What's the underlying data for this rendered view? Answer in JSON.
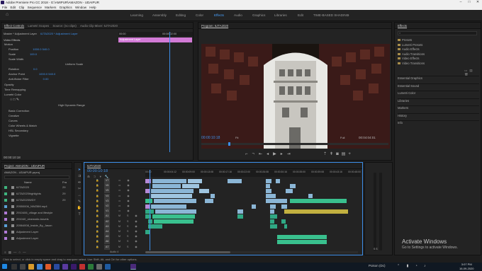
{
  "titlebar": {
    "title": "Adobe Premiere Pro CC 2018 - G:\\AMIPUR\\AMAZON - UDAIPUR"
  },
  "menu": [
    "File",
    "Edit",
    "Clip",
    "Sequence",
    "Markers",
    "Graphics",
    "Window",
    "Help"
  ],
  "workspaces": [
    "Learning",
    "Assembly",
    "Editing",
    "Color",
    "Effects",
    "Audio",
    "Graphics",
    "Libraries",
    "Edit",
    "TIME-BASED SHADING"
  ],
  "active_workspace": "Effects",
  "source_panel": {
    "tabs": [
      "Effect Controls",
      "Lumetri Scopes",
      "Source: (no clips)",
      "Audio Clip Mixer: 6JTA2020"
    ],
    "header": "Master * Adjustment Layer",
    "sequence_ref": "6JTA2020 * Adjustment Layer",
    "ruler_left": "00:00",
    "ruler_right": "00:08:02:00",
    "clip_label": "Adjustment Layer",
    "section": "Video Effects",
    "props": [
      {
        "label": "Motion",
        "value": ""
      },
      {
        "label": "Position",
        "value": "1000.0     540.0"
      },
      {
        "label": "Scale",
        "value": "100.0"
      },
      {
        "label": "Scale Width",
        "value": ""
      },
      {
        "label": "",
        "value": "Uniform Scale"
      },
      {
        "label": "Rotation",
        "value": "0.0"
      },
      {
        "label": "Anchor Point",
        "value": "1000.0     540.0"
      },
      {
        "label": "Anti-flicker Filter",
        "value": "0.00"
      },
      {
        "label": "Opacity",
        "value": ""
      },
      {
        "label": "Time Remapping",
        "value": ""
      },
      {
        "label": "Lumetri Color",
        "value": ""
      },
      {
        "label": "",
        "value": "High Dynamic Range"
      },
      {
        "label": "Basic Correction",
        "value": ""
      },
      {
        "label": "Creative",
        "value": ""
      },
      {
        "label": "Curves",
        "value": ""
      },
      {
        "label": "Color Wheels & Match",
        "value": ""
      },
      {
        "label": "HSL Secondary",
        "value": ""
      },
      {
        "label": "Vignette",
        "value": ""
      }
    ],
    "timecode": "00:00:10:18"
  },
  "program_monitor": {
    "title": "Program: 6JTA2020",
    "timecode": "00:00:10:18",
    "fit": "Fit",
    "quality": "Full",
    "duration": "00:04:04:01"
  },
  "effects_panel": {
    "title": "Effects",
    "items": [
      "Presets",
      "Lumetri Presets",
      "Audio Effects",
      "Audio Transitions",
      "Video Effects",
      "Video Transitions"
    ],
    "sections": [
      "Essential Graphics",
      "Essential Sound",
      "Lumetri Color",
      "Libraries",
      "Markers",
      "History",
      "Info"
    ]
  },
  "project_panel": {
    "title": "Project: AMAZON - UDAIPUR",
    "path": "AMAZON - UDAIPUR.prproj",
    "columns": [
      "Name",
      "Fra"
    ],
    "items": [
      {
        "name": "6JTA2020",
        "color": "#3fb57e"
      },
      {
        "name": "6JTA2020highlights",
        "color": "#3fb57e"
      },
      {
        "name": "6JTA2020WDY",
        "color": "#3fb57e"
      },
      {
        "name": "20550006_NWZ8M.mp4",
        "color": "#5aa0d6"
      },
      {
        "name": "2910406_village and lifestyle",
        "color": "#b07ad6"
      },
      {
        "name": "291040_cinematic-travels",
        "color": "#b07ad6"
      },
      {
        "name": "20564008_Inside_By_Jason",
        "color": "#5aa0d6"
      },
      {
        "name": "Adjustment Layer",
        "color": "#b07ad6"
      },
      {
        "name": "Adjustment Layer",
        "color": "#b07ad6"
      }
    ],
    "frame_values": [
      "29",
      "29",
      "29",
      "",
      "",
      "",
      "",
      "",
      ""
    ]
  },
  "timeline": {
    "tab": "6JTA2020",
    "timecode": "00:00:10:18",
    "ruler": [
      "00:00",
      "00:00:04:12",
      "00:00:09:00",
      "00:00:13:08",
      "00:00:17:16",
      "00:00:22:00",
      "00:00:26:08",
      "00:00:30:16",
      "00:00:35:00",
      "00:00:39:08",
      "00:00:43:16",
      "00:00:48:00"
    ],
    "tracks": [
      "V7",
      "V6",
      "V5",
      "V4",
      "V3",
      "V2",
      "V1",
      "A1",
      "A2",
      "A3",
      "A4",
      "A5",
      "A6",
      "A7"
    ],
    "audio_label": "Audio 4"
  },
  "status_text": "Click to select, or click in empty space and drag to marquee select. Use Shift, Alt, and Ctrl for other options.",
  "activate": {
    "title": "Activate Windows",
    "subtitle": "Go to Settings to activate Windows."
  },
  "taskbar": {
    "lang": "Poison (Dc)",
    "time": "3:07 PM",
    "date": "16-09-2020"
  }
}
